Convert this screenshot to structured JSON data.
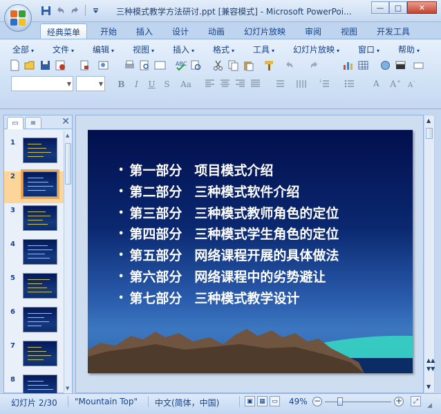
{
  "window": {
    "title": "三种模式教学方法研讨.ppt [兼容模式] - Microsoft PowerPoi...",
    "min_label": "—",
    "max_label": "□",
    "close_label": "✕"
  },
  "ribbon_tabs": [
    "经典菜单",
    "开始",
    "插入",
    "设计",
    "动画",
    "幻灯片放映",
    "审阅",
    "视图",
    "开发工具"
  ],
  "classic_menu": [
    "全部",
    "文件",
    "编辑",
    "视图",
    "插入",
    "格式",
    "工具",
    "幻灯片放映",
    "窗口",
    "帮助"
  ],
  "format_buttons": {
    "bold": "B",
    "italic": "I",
    "underline": "U",
    "strike": "S",
    "case": "Aa"
  },
  "left_panel": {
    "tab_slides": "▭",
    "tab_outline": "≡",
    "close": "✕",
    "thumbnails": [
      {
        "num": "1"
      },
      {
        "num": "2"
      },
      {
        "num": "3"
      },
      {
        "num": "4"
      },
      {
        "num": "5"
      },
      {
        "num": "6"
      },
      {
        "num": "7"
      },
      {
        "num": "8"
      }
    ],
    "selected_index": 1
  },
  "slide": {
    "items": [
      {
        "part": "第一部分",
        "topic": "项目模式介绍"
      },
      {
        "part": "第二部分",
        "topic": "三种模式软件介绍"
      },
      {
        "part": "第三部分",
        "topic": "三种模式教师角色的定位"
      },
      {
        "part": "第四部分",
        "topic": "三种模式学生角色的定位"
      },
      {
        "part": "第五部分",
        "topic": "网络课程开展的具体做法"
      },
      {
        "part": "第六部分",
        "topic": "网络课程中的劣势避让"
      },
      {
        "part": "第七部分",
        "topic": "三种模式教学设计"
      }
    ],
    "bullet": "•"
  },
  "status": {
    "slide_label": "幻灯片 2/30",
    "theme": "\"Mountain Top\"",
    "language": "中文(简体，中国)",
    "zoom": "49%",
    "zoom_minus": "−",
    "zoom_plus": "+"
  },
  "colors": {
    "accent": "#15428b",
    "selected_thumb": "#f3a64a",
    "slide_text": "#ffffff"
  }
}
